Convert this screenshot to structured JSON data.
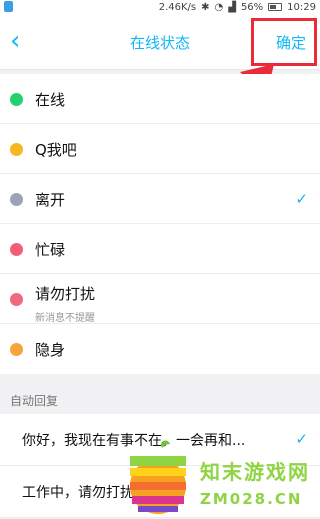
{
  "status_bar": {
    "speed": "2.46K/s",
    "battery": "56%",
    "time": "10:29"
  },
  "header": {
    "back_glyph": "‹",
    "title": "在线状态",
    "confirm_label": "确定"
  },
  "statuses": [
    {
      "label": "在线",
      "sublabel": "",
      "icon": "online-icon",
      "color": "#27d06f",
      "selected": false
    },
    {
      "label": "Q我吧",
      "sublabel": "",
      "icon": "smile-icon",
      "color": "#f5b823",
      "selected": false
    },
    {
      "label": "离开",
      "sublabel": "",
      "icon": "clock-icon",
      "color": "#9aa4b6",
      "selected": true
    },
    {
      "label": "忙碌",
      "sublabel": "",
      "icon": "busy-icon",
      "color": "#f25d7c",
      "selected": false
    },
    {
      "label": "请勿打扰",
      "sublabel": "新消息不提醒",
      "icon": "no-disturb-icon",
      "color": "#f06a7e",
      "selected": false
    },
    {
      "label": "隐身",
      "sublabel": "",
      "icon": "invisible-icon",
      "color": "#f7a53a",
      "selected": false
    }
  ],
  "check_glyph": "✓",
  "auto_reply": {
    "section_title": "自动回复",
    "items": [
      {
        "text": "你好，我现在有事不在，一会再和...",
        "selected": true
      },
      {
        "text": "工作中，请勿打扰",
        "selected": false
      }
    ]
  },
  "watermark": {
    "line1": "知末游戏网",
    "line2": "ZM028.CN"
  },
  "accent_color": "#12b7f5",
  "annotation_color": "#ea2c39"
}
